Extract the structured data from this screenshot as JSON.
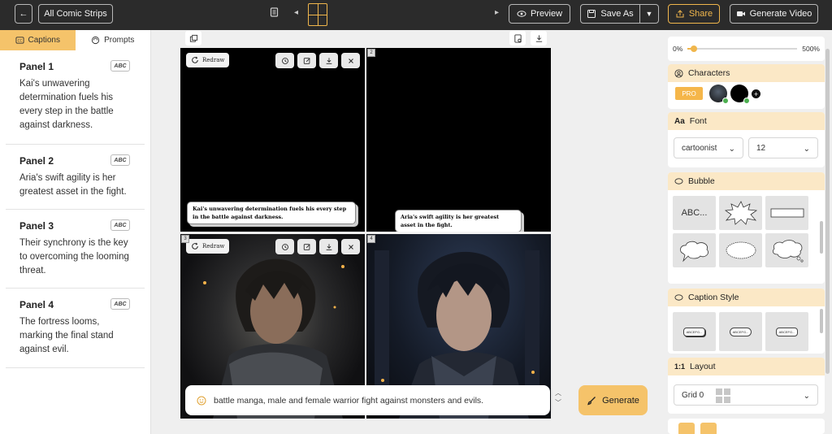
{
  "topbar": {
    "back_label": "←",
    "all_strips": "All Comic Strips",
    "preview": "Preview",
    "save_as": "Save As",
    "share": "Share",
    "generate_video": "Generate Video"
  },
  "sidebar": {
    "tabs": [
      "Captions",
      "Prompts"
    ],
    "badge": "ABC",
    "panels": [
      {
        "title": "Panel 1",
        "caption": "Kai's unwavering determination fuels his every step in the battle against darkness."
      },
      {
        "title": "Panel 2",
        "caption": "Aria's swift agility is her greatest asset in the fight."
      },
      {
        "title": "Panel 3",
        "caption": "Their synchrony is the key to overcoming the looming threat."
      },
      {
        "title": "Panel 4",
        "caption": "The fortress looms, marking the final stand against evil."
      }
    ]
  },
  "canvas": {
    "redraw": "Redraw",
    "panel_numbers": [
      "2",
      "3",
      "4"
    ],
    "bubbles": [
      "Kai's unwavering determination fuels his every step in the battle against darkness.",
      "Aria's swift agility is her greatest asset in the fight."
    ],
    "prompt": "battle manga, male and female warrior fight against monsters and evils.",
    "generate": "Generate"
  },
  "right": {
    "zoom_min": "0%",
    "zoom_max": "500%",
    "zoom_value_fraction": 0.06,
    "characters": "Characters",
    "pro": "PRO",
    "font": "Font",
    "font_family": "cartoonist",
    "font_size": "12",
    "bubble": "Bubble",
    "bubble_text": "ABC...",
    "caption_style": "Caption Style",
    "caption_sample": "ABCEFG...",
    "layout_icon": "1:1",
    "layout": "Layout",
    "grid": "Grid 0"
  },
  "colors": {
    "accent": "#f5c36a",
    "topbar": "#2b2b2b",
    "card_header": "#fbe8c6"
  }
}
